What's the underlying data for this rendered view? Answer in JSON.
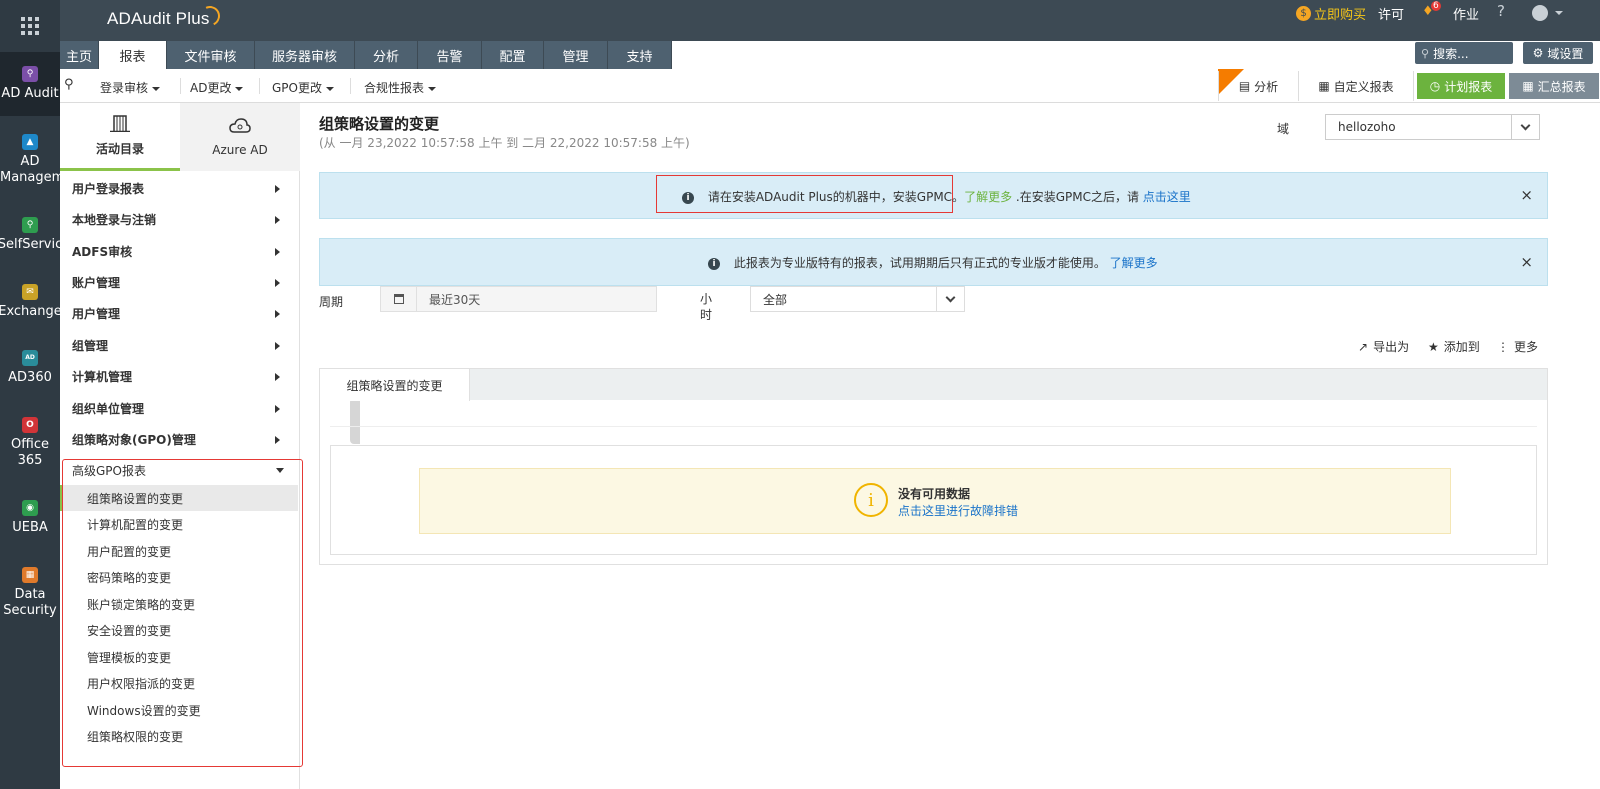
{
  "app": {
    "logo": "ADAudit Plus"
  },
  "rail": {
    "items": [
      {
        "label": "AD Audit",
        "icon": "audit-icon",
        "color": "#7b4fa8"
      },
      {
        "label": "AD Managem",
        "icon": "ad-management-icon",
        "color": "#1e88c9"
      },
      {
        "label": "SelfServic",
        "icon": "key-icon",
        "color": "#2e9d4f"
      },
      {
        "label": "Exchange",
        "icon": "mail-icon",
        "color": "#c9a227"
      },
      {
        "label": "AD360",
        "icon": "ad360-icon",
        "color": "#2a8c9a"
      },
      {
        "label": "Office 365",
        "icon": "office-icon",
        "color": "#d13438"
      },
      {
        "label": "UEBA",
        "icon": "eye-icon",
        "color": "#2e9d4f"
      },
      {
        "label": "Data Security",
        "icon": "data-security-icon",
        "color": "#e07a2b"
      }
    ]
  },
  "topbar": {
    "buy": "立即购买",
    "license": "许可",
    "notifications_count": "6",
    "jobs": "作业",
    "help": "?"
  },
  "main_tabs": [
    "主页",
    "报表",
    "文件审核",
    "服务器审核",
    "分析",
    "告警",
    "配置",
    "管理",
    "支持"
  ],
  "search": {
    "placeholder": "搜索..."
  },
  "domain_settings": "域设置",
  "subbar": {
    "items": [
      "登录审核",
      "AD更改",
      "GPO更改",
      "合规性报表"
    ],
    "analysis": "分析",
    "new_badge": "NEW",
    "custom_reports": "自定义报表",
    "schedule_reports": "计划报表",
    "summary_reports": "汇总报表"
  },
  "nav": {
    "tab_active": "活动目录",
    "tab_inactive": "Azure AD",
    "categories": [
      "用户登录报表",
      "本地登录与注销",
      "ADFS审核",
      "账户管理",
      "用户管理",
      "组管理",
      "计算机管理",
      "组织单位管理",
      "组策略对象(GPO)管理"
    ],
    "expanded_category": "高级GPO报表",
    "sub_items": [
      "组策略设置的变更",
      "计算机配置的变更",
      "用户配置的变更",
      "密码策略的变更",
      "账户锁定策略的变更",
      "安全设置的变更",
      "管理模板的变更",
      "用户权限指派的变更",
      "Windows设置的变更",
      "组策略权限的变更"
    ]
  },
  "main": {
    "title": "组策略设置的变更",
    "subtitle": "(从 一月 23,2022 10:57:58 上午 到 二月 22,2022 10:57:58 上午)",
    "domain_label": "域",
    "domain_value": "hellozoho",
    "alert1": {
      "text": "请在安装ADAudit Plus的机器中，安装GPMC。",
      "link1": "了解更多",
      "middle": " .在安装GPMC之后，请 ",
      "link2": "点击这里"
    },
    "alert2": {
      "text": "此报表为专业版特有的报表，试用期期后只有正式的专业版才能使用。",
      "link": "了解更多"
    },
    "period_label": "周期",
    "period_value": "最近30天",
    "hour_label": "小时",
    "hour_value": "全部",
    "export": "导出为",
    "add_to": "添加到",
    "more": "更多",
    "report_tab": "组策略设置的变更",
    "no_data_title": "没有可用数据",
    "no_data_link": "点击这里进行故障排错"
  }
}
